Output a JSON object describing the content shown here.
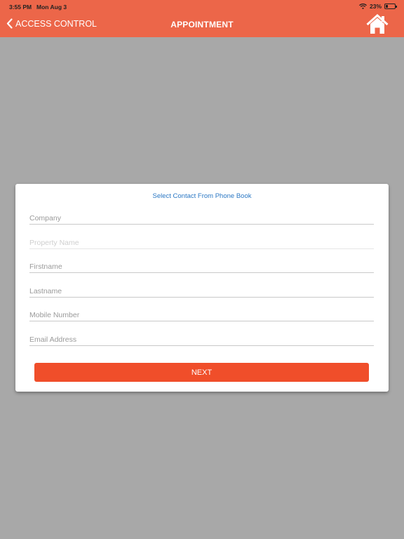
{
  "status_bar": {
    "time": "3:55 PM",
    "date": "Mon Aug 3",
    "battery": "23%",
    "battery_level": 0.23
  },
  "nav": {
    "back_label": "ACCESS CONTROL",
    "title": "APPOINTMENT",
    "home_icon": "home-icon",
    "bar_color": "#ec6649"
  },
  "form": {
    "contact_link": "Select Contact From Phone Book",
    "fields": {
      "company": {
        "placeholder": "Company",
        "value": ""
      },
      "property_name": {
        "placeholder": "Property Name",
        "value": ""
      },
      "firstname": {
        "placeholder": "Firstname",
        "value": ""
      },
      "lastname": {
        "placeholder": "Lastname",
        "value": ""
      },
      "mobile": {
        "placeholder": "Mobile Number",
        "value": ""
      },
      "email": {
        "placeholder": "Email Address",
        "value": ""
      }
    },
    "next_label": "NEXT",
    "button_color": "#f04e2a"
  }
}
